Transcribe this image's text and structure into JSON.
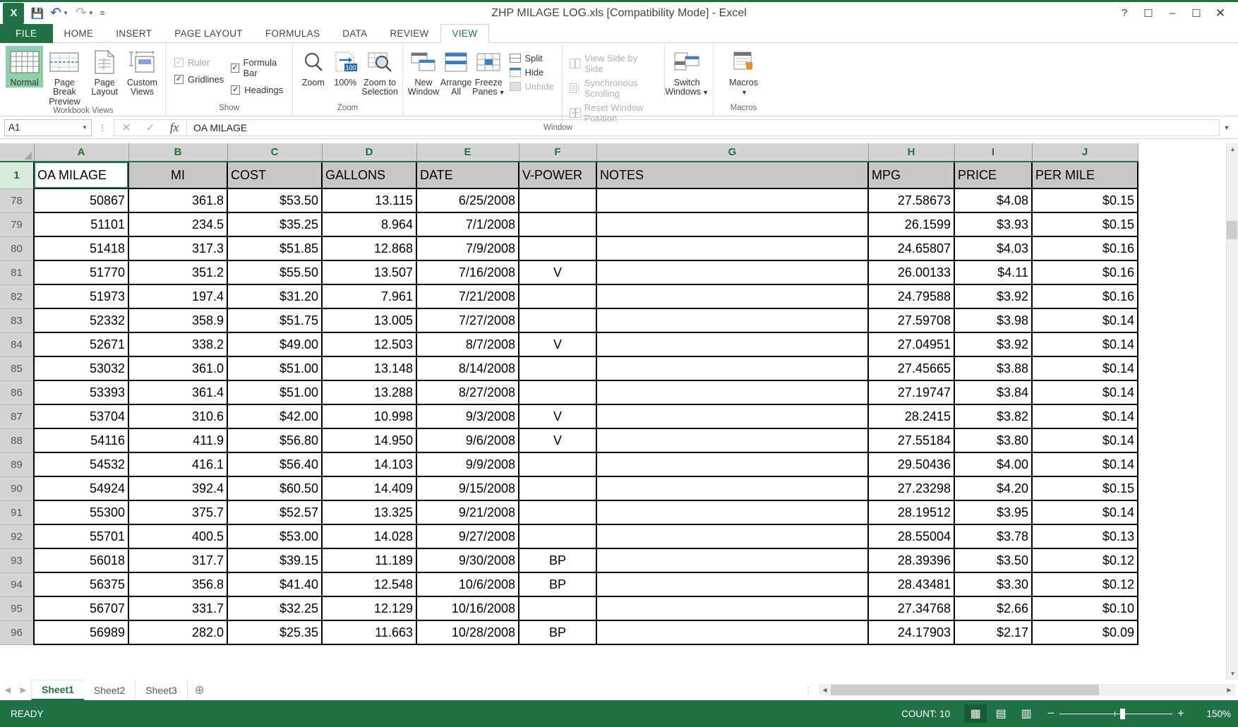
{
  "window": {
    "title": "ZHP MILAGE LOG.xls  [Compatibility Mode] - Excel",
    "logo": "X",
    "help_icon": "?",
    "ribbon_display_icon": "⬜",
    "minimize_icon": "–",
    "restore_icon": "❐",
    "close_icon": "✕"
  },
  "quick_access": {
    "save_icon": "💾",
    "undo_icon": "↶",
    "redo_icon": "↷",
    "more_icon": "≡"
  },
  "ribbon_tabs": [
    {
      "label": "FILE",
      "active": false
    },
    {
      "label": "HOME",
      "active": false
    },
    {
      "label": "INSERT",
      "active": false
    },
    {
      "label": "PAGE LAYOUT",
      "active": false
    },
    {
      "label": "FORMULAS",
      "active": false
    },
    {
      "label": "DATA",
      "active": false
    },
    {
      "label": "REVIEW",
      "active": false
    },
    {
      "label": "VIEW",
      "active": true
    }
  ],
  "ribbon": {
    "groups": [
      {
        "title": "Workbook Views",
        "buttons": [
          {
            "label_1": "Normal",
            "label_2": "",
            "selected": true
          },
          {
            "label_1": "Page Break",
            "label_2": "Preview",
            "selected": false
          },
          {
            "label_1": "Page",
            "label_2": "Layout",
            "selected": false
          },
          {
            "label_1": "Custom",
            "label_2": "Views",
            "selected": false
          }
        ]
      },
      {
        "title": "Show",
        "checks": [
          {
            "label": "Ruler",
            "checked": true,
            "disabled": true
          },
          {
            "label": "Formula Bar",
            "checked": true,
            "disabled": false
          },
          {
            "label": "Gridlines",
            "checked": true,
            "disabled": false
          },
          {
            "label": "Headings",
            "checked": true,
            "disabled": false
          }
        ]
      },
      {
        "title": "Zoom",
        "buttons": [
          {
            "label_1": "Zoom",
            "label_2": "",
            "selected": false
          },
          {
            "label_1": "100%",
            "label_2": "",
            "selected": false
          },
          {
            "label_1": "Zoom to",
            "label_2": "Selection",
            "selected": false
          }
        ]
      },
      {
        "title": "Window",
        "buttons": [
          {
            "label_1": "New",
            "label_2": "Window",
            "selected": false
          },
          {
            "label_1": "Arrange",
            "label_2": "All",
            "selected": false
          },
          {
            "label_1": "Freeze",
            "label_2": "Panes",
            "selected": false,
            "dropdown": true
          }
        ],
        "small_left": [
          {
            "label": "Split",
            "disabled": false
          },
          {
            "label": "Hide",
            "disabled": false
          },
          {
            "label": "Unhide",
            "disabled": true
          }
        ],
        "small_right": [
          {
            "label": "View Side by Side",
            "disabled": true
          },
          {
            "label": "Synchronous Scrolling",
            "disabled": true
          },
          {
            "label": "Reset Window Position",
            "disabled": true
          }
        ],
        "switch": {
          "label_1": "Switch",
          "label_2": "Windows",
          "dropdown": true
        }
      },
      {
        "title": "Macros",
        "macros": {
          "label_1": "Macros",
          "label_2": "",
          "dropdown": true
        }
      }
    ]
  },
  "formula_bar": {
    "name_box": "A1",
    "cancel_icon": "✕",
    "enter_icon": "✓",
    "function_icon": "fx",
    "formula_value": "OA MILAGE",
    "expand_icon": "⌵"
  },
  "grid": {
    "columns": [
      "A",
      "B",
      "C",
      "D",
      "E",
      "F",
      "G",
      "H",
      "I",
      "J"
    ],
    "active_cell": "A1",
    "header_row_number": "1",
    "header_row": [
      "OA MILAGE",
      "MI",
      "COST",
      "GALLONS",
      "DATE",
      "V-POWER",
      "NOTES",
      "MPG",
      "PRICE",
      "PER MILE"
    ],
    "rows": [
      {
        "n": "78",
        "cells": [
          "50867",
          "361.8",
          "$53.50",
          "13.115",
          "6/25/2008",
          "",
          "",
          "27.58673",
          "$4.08",
          "$0.15"
        ]
      },
      {
        "n": "79",
        "cells": [
          "51101",
          "234.5",
          "$35.25",
          "8.964",
          "7/1/2008",
          "",
          "",
          "26.1599",
          "$3.93",
          "$0.15"
        ]
      },
      {
        "n": "80",
        "cells": [
          "51418",
          "317.3",
          "$51.85",
          "12.868",
          "7/9/2008",
          "",
          "",
          "24.65807",
          "$4.03",
          "$0.16"
        ]
      },
      {
        "n": "81",
        "cells": [
          "51770",
          "351.2",
          "$55.50",
          "13.507",
          "7/16/2008",
          "V",
          "",
          "26.00133",
          "$4.11",
          "$0.16"
        ]
      },
      {
        "n": "82",
        "cells": [
          "51973",
          "197.4",
          "$31.20",
          "7.961",
          "7/21/2008",
          "",
          "",
          "24.79588",
          "$3.92",
          "$0.16"
        ]
      },
      {
        "n": "83",
        "cells": [
          "52332",
          "358.9",
          "$51.75",
          "13.005",
          "7/27/2008",
          "",
          "",
          "27.59708",
          "$3.98",
          "$0.14"
        ]
      },
      {
        "n": "84",
        "cells": [
          "52671",
          "338.2",
          "$49.00",
          "12.503",
          "8/7/2008",
          "V",
          "",
          "27.04951",
          "$3.92",
          "$0.14"
        ]
      },
      {
        "n": "85",
        "cells": [
          "53032",
          "361.0",
          "$51.00",
          "13.148",
          "8/14/2008",
          "",
          "",
          "27.45665",
          "$3.88",
          "$0.14"
        ]
      },
      {
        "n": "86",
        "cells": [
          "53393",
          "361.4",
          "$51.00",
          "13.288",
          "8/27/2008",
          "",
          "",
          "27.19747",
          "$3.84",
          "$0.14"
        ]
      },
      {
        "n": "87",
        "cells": [
          "53704",
          "310.6",
          "$42.00",
          "10.998",
          "9/3/2008",
          "V",
          "",
          "28.2415",
          "$3.82",
          "$0.14"
        ]
      },
      {
        "n": "88",
        "cells": [
          "54116",
          "411.9",
          "$56.80",
          "14.950",
          "9/6/2008",
          "V",
          "",
          "27.55184",
          "$3.80",
          "$0.14"
        ]
      },
      {
        "n": "89",
        "cells": [
          "54532",
          "416.1",
          "$56.40",
          "14.103",
          "9/9/2008",
          "",
          "",
          "29.50436",
          "$4.00",
          "$0.14"
        ]
      },
      {
        "n": "90",
        "cells": [
          "54924",
          "392.4",
          "$60.50",
          "14.409",
          "9/15/2008",
          "",
          "",
          "27.23298",
          "$4.20",
          "$0.15"
        ]
      },
      {
        "n": "91",
        "cells": [
          "55300",
          "375.7",
          "$52.57",
          "13.325",
          "9/21/2008",
          "",
          "",
          "28.19512",
          "$3.95",
          "$0.14"
        ]
      },
      {
        "n": "92",
        "cells": [
          "55701",
          "400.5",
          "$53.00",
          "14.028",
          "9/27/2008",
          "",
          "",
          "28.55004",
          "$3.78",
          "$0.13"
        ]
      },
      {
        "n": "93",
        "cells": [
          "56018",
          "317.7",
          "$39.15",
          "11.189",
          "9/30/2008",
          "BP",
          "",
          "28.39396",
          "$3.50",
          "$0.12"
        ]
      },
      {
        "n": "94",
        "cells": [
          "56375",
          "356.8",
          "$41.40",
          "12.548",
          "10/6/2008",
          "BP",
          "",
          "28.43481",
          "$3.30",
          "$0.12"
        ]
      },
      {
        "n": "95",
        "cells": [
          "56707",
          "331.7",
          "$32.25",
          "12.129",
          "10/16/2008",
          "",
          "",
          "27.34768",
          "$2.66",
          "$0.10"
        ]
      },
      {
        "n": "96",
        "cells": [
          "56989",
          "282.0",
          "$25.35",
          "11.663",
          "10/28/2008",
          "BP",
          "",
          "24.17903",
          "$2.17",
          "$0.09"
        ]
      }
    ]
  },
  "sheet_tabs": {
    "first_icon": "◀",
    "prev_icon": "▶",
    "tabs": [
      {
        "label": "Sheet1",
        "active": true
      },
      {
        "label": "Sheet2",
        "active": false
      },
      {
        "label": "Sheet3",
        "active": false
      }
    ],
    "add_icon": "⊕"
  },
  "status_bar": {
    "ready": "READY",
    "count": "COUNT: 10",
    "view_normal_icon": "▦",
    "view_layout_icon": "▤",
    "view_pagebreak_icon": "▥",
    "zoom_out_icon": "−",
    "zoom_in_icon": "+",
    "zoom_level": "150%"
  },
  "colors": {
    "accent_green": "#207245",
    "header_gray": "#c8c8c8",
    "col_header_gray": "#d4d4d4"
  }
}
